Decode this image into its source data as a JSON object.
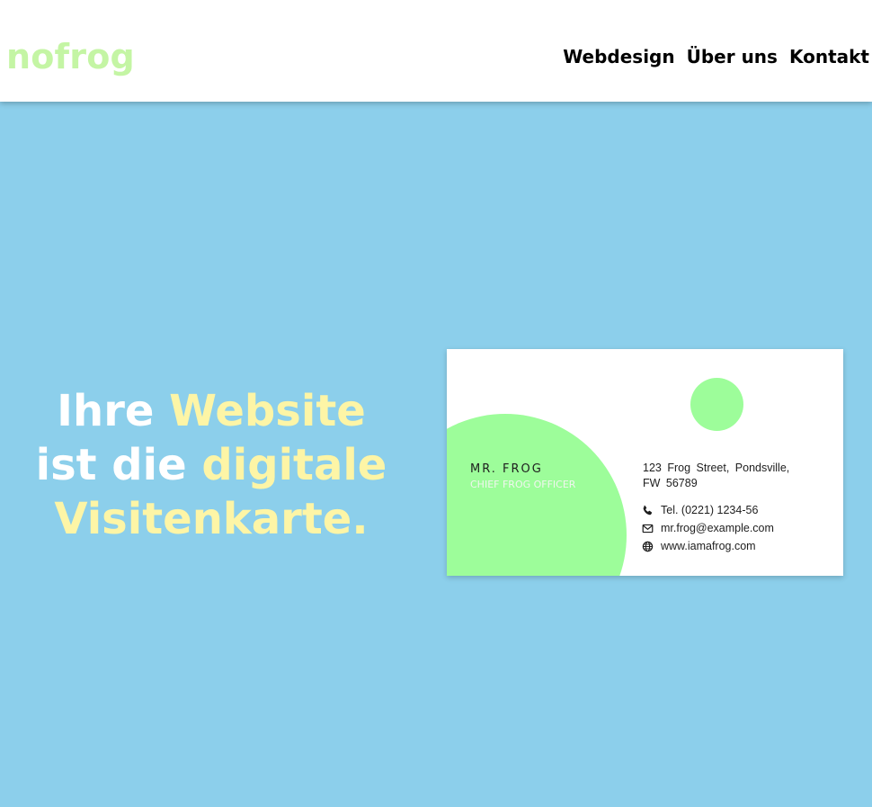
{
  "header": {
    "logo": "nofrog",
    "nav": [
      {
        "label": "Webdesign"
      },
      {
        "label": "Über uns"
      },
      {
        "label": "Kontakt"
      }
    ]
  },
  "hero": {
    "headline": {
      "part1": "Ihre ",
      "part2": "Website",
      "part3": "ist die ",
      "part4": "digitale",
      "part5": "Visitenkarte."
    },
    "colors": {
      "background": "#8ccfeb",
      "highlight": "#fdf5a6",
      "text": "#ffffff"
    }
  },
  "card": {
    "name": "MR. FROG",
    "role": "CHIEF FROG OFFICER",
    "address_line1": "123 Frog Street, Pondsville,",
    "address_line2": "FW 56789",
    "phone": "Tel. (0221) 1234-56",
    "email": "mr.frog@example.com",
    "website": "www.iamafrog.com",
    "icons": {
      "phone": "phone-icon",
      "email": "mail-icon",
      "website": "globe-icon"
    },
    "accent_color": "#9dfd9a"
  }
}
